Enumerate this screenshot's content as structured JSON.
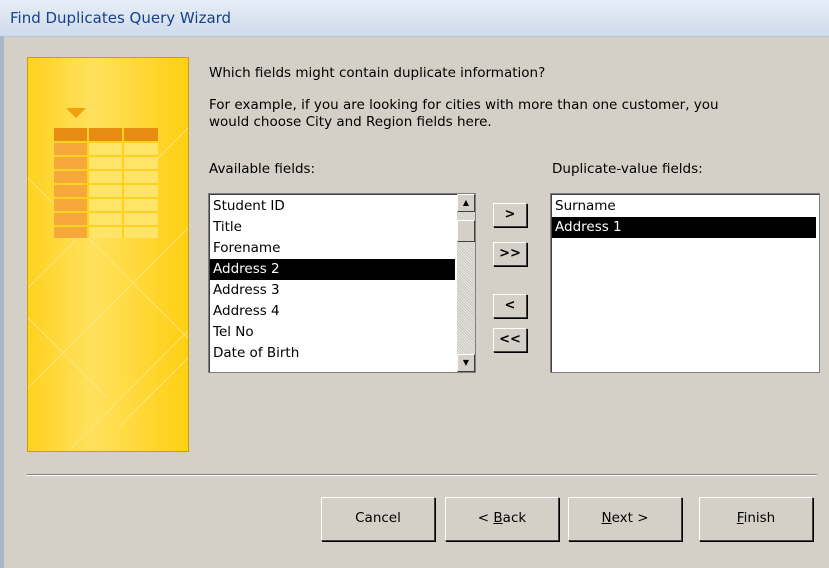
{
  "window": {
    "title": "Find Duplicates Query Wizard"
  },
  "prompt": "Which fields might contain duplicate information?",
  "example_line1": "For example, if you are looking for cities with more than one customer, you",
  "example_line2": "would choose City and Region fields here.",
  "available": {
    "label": "Available fields:",
    "items": [
      "Student ID",
      "Title",
      "Forename",
      "Address 2",
      "Address 3",
      "Address 4",
      "Tel No",
      "Date of Birth"
    ],
    "selected": "Address 2"
  },
  "duplicate": {
    "label": "Duplicate-value fields:",
    "items": [
      "Surname",
      "Address 1"
    ],
    "selected": "Address 1"
  },
  "move_buttons": {
    "add": ">",
    "add_all": ">>",
    "remove": "<",
    "remove_all": "<<"
  },
  "buttons": {
    "cancel": "Cancel",
    "back_mnemonic": "B",
    "back_rest": "ack",
    "back_prefix": "< ",
    "next_mnemonic": "N",
    "next_rest": "ext >",
    "finish_mnemonic": "F",
    "finish_rest": "inish"
  },
  "colors": {
    "title_text": "#15428b",
    "art_yellow": "#ffd21f",
    "art_orange": "#f5a623",
    "selection": "#000000"
  }
}
